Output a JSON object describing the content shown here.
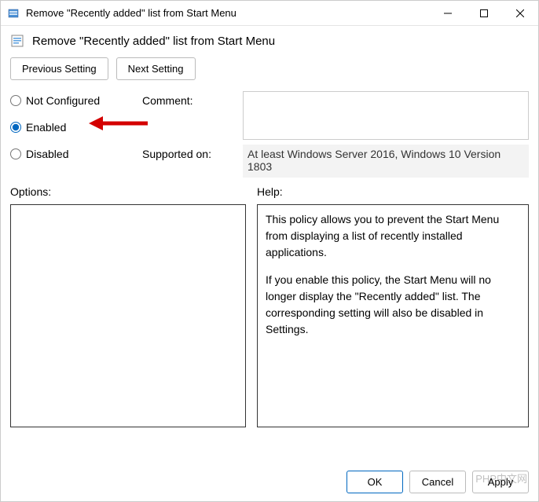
{
  "window": {
    "title": "Remove \"Recently added\" list from Start Menu"
  },
  "subheader": {
    "title": "Remove \"Recently added\" list from Start Menu"
  },
  "nav": {
    "previous": "Previous Setting",
    "next": "Next Setting"
  },
  "radios": {
    "not_configured": "Not Configured",
    "enabled": "Enabled",
    "disabled": "Disabled",
    "selected": "enabled"
  },
  "labels": {
    "comment": "Comment:",
    "supported_on": "Supported on:",
    "options": "Options:",
    "help": "Help:"
  },
  "comment_value": "",
  "supported_on_value": "At least Windows Server 2016, Windows 10 Version 1803",
  "options_value": "",
  "help_value": "This policy allows you to prevent the Start Menu from displaying a list of recently installed applications.\n\nIf you enable this policy, the Start Menu will no longer display the \"Recently added\" list. The corresponding setting will also be disabled in Settings.",
  "footer": {
    "ok": "OK",
    "cancel": "Cancel",
    "apply": "Apply"
  },
  "watermark": "PHP中文网"
}
